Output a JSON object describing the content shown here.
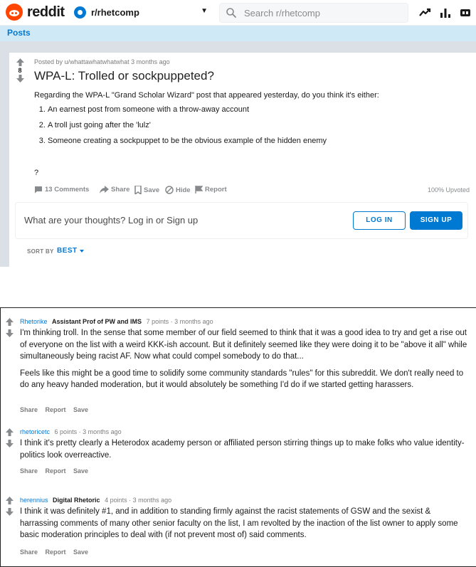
{
  "header": {
    "logo_text": "reddit",
    "subreddit": "r/rhetcomp",
    "search_placeholder": "Search r/rhetcomp",
    "posts_tab": "Posts",
    "colors": {
      "accent": "#0079d3",
      "brand": "#ff4500"
    },
    "icons": [
      "trending-icon",
      "stats-icon",
      "moderation-icon"
    ]
  },
  "post": {
    "score": "8",
    "meta": "Posted by u/whattawhatwhatwhat 3 months ago",
    "title": "WPA-L: Trolled or sockpuppeted?",
    "intro": "Regarding the WPA-L \"Grand Scholar Wizard\" post that appeared yesterday, do you think it's either:",
    "options": [
      "An earnest post from someone with a throw-away account",
      "A troll just going after the 'lulz'",
      "Someone creating a sockpuppet to be the obvious example of the hidden enemy"
    ],
    "closing": "?",
    "actions": {
      "comments": "13 Comments",
      "share": "Share",
      "save": "Save",
      "hide": "Hide",
      "report": "Report"
    },
    "upvoted": "100% Upvoted"
  },
  "comment_box": {
    "prompt": "What are your thoughts? Log in or Sign up",
    "login": "LOG IN",
    "signup": "SIGN UP"
  },
  "sort": {
    "label": "SORT BY",
    "value": "BEST"
  },
  "comments": [
    {
      "author": "Rhetorike",
      "flair": "Assistant Prof of PW and IMS",
      "points": "7 points · 3 months ago",
      "paragraphs": [
        "I'm thinking troll. In the sense that some member of our field seemed to think that it was a good idea to try and get a rise out of everyone on the list with a weird KKK-ish account. But it definitely seemed like they were doing it to be \"above it all\" while simultaneously being racist AF. Now what could compel somebody to do that...",
        "Feels like this might be a good time to solidify some community standards \"rules\" for this subreddit. We don't really need to do any heavy handed moderation, but it would absolutely be something I'd do if we started getting harassers."
      ],
      "actions": [
        "Share",
        "Report",
        "Save"
      ]
    },
    {
      "author": "rhetoricetc",
      "flair": "",
      "points": "6 points · 3 months ago",
      "paragraphs": [
        "I think it's pretty clearly a Heterodox academy person or affiliated person stirring things up to make folks who value identity-politics look overreactive."
      ],
      "actions": [
        "Share",
        "Report",
        "Save"
      ]
    },
    {
      "author": "herennius",
      "flair": "Digital Rhetoric",
      "points": "4 points · 3 months ago",
      "paragraphs": [
        "I think it was definitely #1, and in addition to standing firmly against the racist statements of GSW and the sexist & harrassing comments of many other senior faculty on the list, I am revolted by the inaction of the list owner to apply some basic moderation principles to deal with (if not prevent most of) said comments."
      ],
      "actions": [
        "Share",
        "Report",
        "Save"
      ]
    }
  ]
}
